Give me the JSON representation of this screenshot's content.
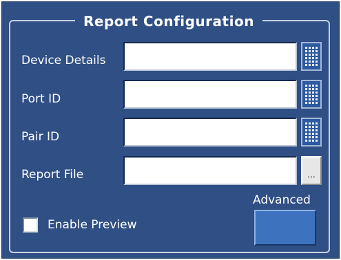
{
  "group": {
    "title": "Report Configuration"
  },
  "fields": [
    {
      "label": "Device Details",
      "value": "",
      "button_icon": "keypad-icon"
    },
    {
      "label": "Port ID",
      "value": "",
      "button_icon": "keypad-icon"
    },
    {
      "label": "Pair ID",
      "value": "",
      "button_icon": "keypad-icon"
    },
    {
      "label": "Report File",
      "value": "",
      "button_icon": "browse-icon",
      "button_label": "..."
    }
  ],
  "enable_preview": {
    "label": "Enable Preview",
    "checked": false
  },
  "advanced": {
    "label": "Advanced",
    "button_label": ""
  },
  "colors": {
    "panel_background": "#2f4f85",
    "frame_border": "#c9d3e4",
    "label_text": "#ffffff",
    "advanced_button": "#3d72bf",
    "keypad_button": "#2d5aa0"
  }
}
